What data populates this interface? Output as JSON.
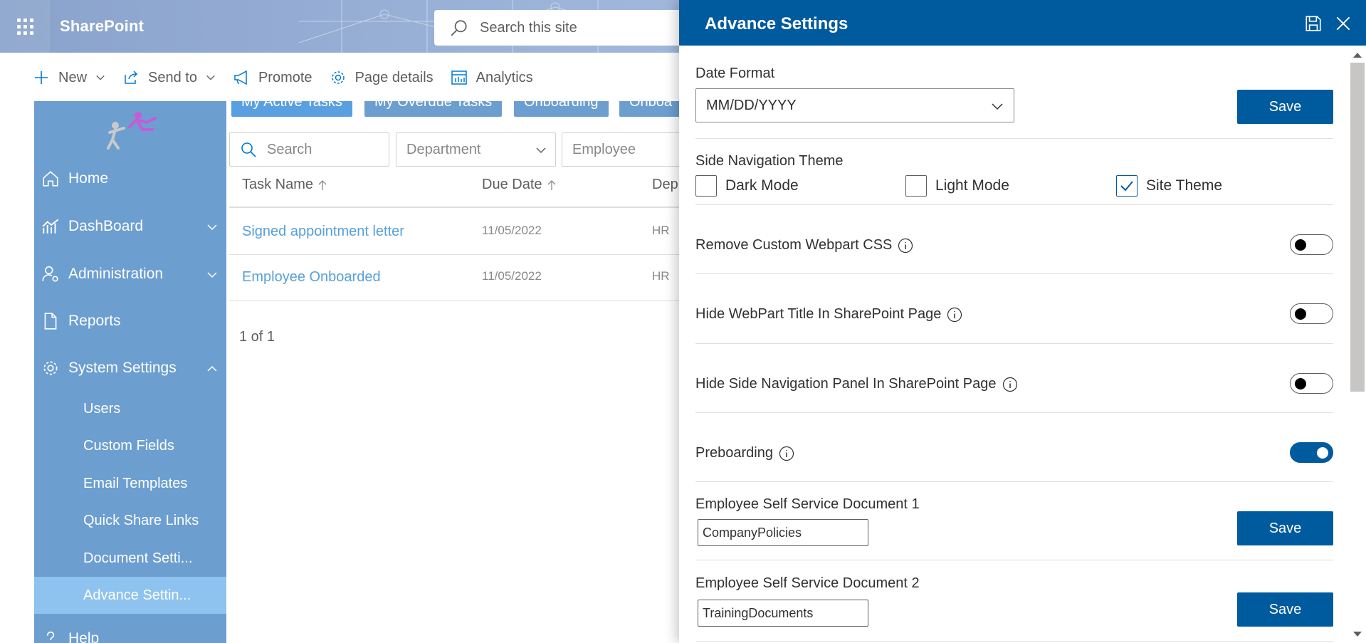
{
  "suitebar": {
    "app_name": "SharePoint",
    "search_placeholder": "Search this site"
  },
  "commandbar": {
    "new_label": "New",
    "send_to_label": "Send to",
    "promote_label": "Promote",
    "page_details_label": "Page details",
    "analytics_label": "Analytics"
  },
  "sidebar": {
    "items": [
      {
        "label": "Home"
      },
      {
        "label": "DashBoard"
      },
      {
        "label": "Administration"
      },
      {
        "label": "Reports"
      },
      {
        "label": "System Settings"
      }
    ],
    "sub_items": [
      {
        "label": "Users"
      },
      {
        "label": "Custom Fields"
      },
      {
        "label": "Email Templates"
      },
      {
        "label": "Quick Share Links"
      },
      {
        "label": "Document Setti..."
      },
      {
        "label": "Advance Settin..."
      }
    ],
    "help_label": "Help"
  },
  "main": {
    "tabs": [
      "My Active Tasks",
      "My Overdue Tasks",
      "Onboarding",
      "Onboa"
    ],
    "filters": {
      "search_placeholder": "Search",
      "department_placeholder": "Department",
      "employee_placeholder": "Employee"
    },
    "columns": {
      "task_name": "Task Name",
      "due_date": "Due Date",
      "department": "Dep"
    },
    "rows": [
      {
        "task": "Signed appointment letter",
        "due": "11/05/2022",
        "dept": "HR"
      },
      {
        "task": "Employee Onboarded",
        "due": "11/05/2022",
        "dept": "HR"
      }
    ],
    "pager": "1 of 1"
  },
  "panel": {
    "title": "Advance Settings",
    "date_format": {
      "label": "Date Format",
      "value": "MM/DD/YYYY",
      "save_label": "Save"
    },
    "side_nav_theme": {
      "label": "Side Navigation Theme",
      "options": [
        {
          "label": "Dark Mode",
          "checked": false
        },
        {
          "label": "Light Mode",
          "checked": false
        },
        {
          "label": "Site Theme",
          "checked": true
        }
      ]
    },
    "toggles": [
      {
        "label": "Remove Custom Webpart CSS",
        "on": false
      },
      {
        "label": "Hide WebPart Title In SharePoint Page",
        "on": false
      },
      {
        "label": "Hide Side Navigation Panel In SharePoint Page",
        "on": false
      },
      {
        "label": "Preboarding",
        "on": true
      }
    ],
    "ess_doc_1": {
      "label": "Employee Self Service Document 1",
      "value": "CompanyPolicies",
      "save_label": "Save"
    },
    "ess_doc_2": {
      "label": "Employee Self Service Document 2",
      "value": "TrainingDocuments",
      "save_label": "Save"
    }
  },
  "colors": {
    "primary": "#005a9e",
    "nav_bg": "#6c9ed0",
    "nav_active": "#8ec3ef",
    "link": "#56a0dc"
  }
}
